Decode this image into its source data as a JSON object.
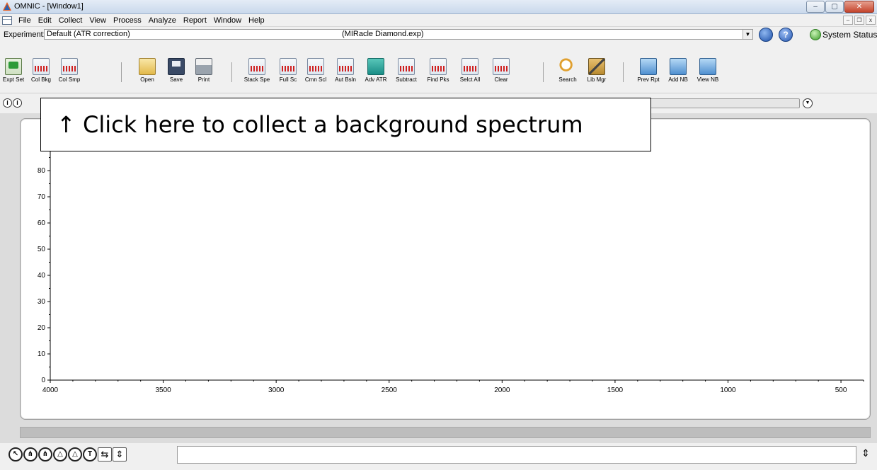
{
  "window": {
    "title": "OMNIC - [Window1]",
    "buttons": {
      "minimize": "–",
      "maximize": "▢",
      "close": "✕"
    }
  },
  "menu": {
    "items": [
      {
        "label": "File"
      },
      {
        "label": "Edit"
      },
      {
        "label": "Collect"
      },
      {
        "label": "View"
      },
      {
        "label": "Process"
      },
      {
        "label": "Analyze"
      },
      {
        "label": "Report"
      },
      {
        "label": "Window"
      },
      {
        "label": "Help"
      }
    ],
    "mdi": {
      "minimize": "–",
      "restore": "❐",
      "close": "x"
    }
  },
  "experiment": {
    "label": "Experiment:",
    "value": "Default (ATR correction)",
    "file": "(MIRacle Diamond.exp)",
    "status": "System Status"
  },
  "toolbar": {
    "buttons": [
      {
        "label": "Expt Set",
        "icon": "expt-set-icon"
      },
      {
        "label": "Col Bkg",
        "icon": "collect-background-icon"
      },
      {
        "label": "Col Smp",
        "icon": "collect-sample-icon"
      },
      {
        "label": "Open",
        "icon": "open-folder-icon"
      },
      {
        "label": "Save",
        "icon": "save-disk-icon"
      },
      {
        "label": "Print",
        "icon": "printer-icon"
      },
      {
        "label": "Stack Spe",
        "icon": "stack-spectra-icon"
      },
      {
        "label": "Full Sc",
        "icon": "full-scale-icon"
      },
      {
        "label": "Cmn Scl",
        "icon": "common-scale-icon"
      },
      {
        "label": "Aut Bsln",
        "icon": "auto-baseline-icon"
      },
      {
        "label": "Adv ATR",
        "icon": "advanced-atr-icon"
      },
      {
        "label": "Subtract",
        "icon": "subtract-icon"
      },
      {
        "label": "Find Pks",
        "icon": "find-peaks-icon"
      },
      {
        "label": "Selct All",
        "icon": "select-all-icon"
      },
      {
        "label": "Clear",
        "icon": "clear-icon"
      },
      {
        "label": "Search",
        "icon": "search-icon"
      },
      {
        "label": "Lib Mgr",
        "icon": "library-manager-icon"
      },
      {
        "label": "Prev Rpt",
        "icon": "preview-report-icon"
      },
      {
        "label": "Add NB",
        "icon": "add-notebook-icon"
      },
      {
        "label": "View NB",
        "icon": "view-notebook-icon"
      }
    ]
  },
  "display": {
    "icons": [
      "i",
      "i"
    ]
  },
  "chart_data": {
    "type": "line",
    "title": "",
    "xlabel": "",
    "ylabel": "",
    "xlim": [
      4000,
      400
    ],
    "ylim": [
      0,
      100
    ],
    "x_ticks": [
      4000,
      3500,
      3000,
      2500,
      2000,
      1500,
      1000,
      500
    ],
    "y_ticks": [
      0,
      10,
      20,
      30,
      40,
      50,
      60,
      70,
      80
    ],
    "series": []
  },
  "callout": {
    "text": "↑ Click here to collect a background spectrum"
  },
  "bottom_tools": {
    "labels": [
      "↖",
      "⋔",
      "⋔",
      "△",
      "△",
      "T",
      "⇆",
      "⇕"
    ]
  }
}
